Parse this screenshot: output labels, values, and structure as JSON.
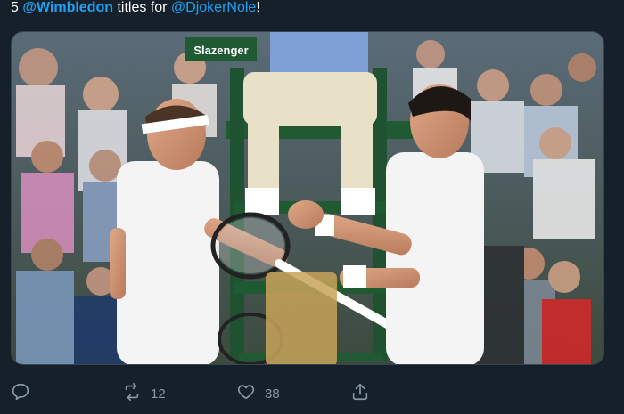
{
  "tweet": {
    "text_prefix": "5 ",
    "mention_1": "@Wimbledon",
    "text_middle": " titles for ",
    "mention_2": "@DjokerNole",
    "text_suffix": "!"
  },
  "media": {
    "chair_sign": "Slazenger",
    "scene": "photo"
  },
  "actions": {
    "reply_icon": "reply-icon",
    "retweet_icon": "retweet-icon",
    "retweet_count": "12",
    "like_icon": "heart-icon",
    "like_count": "38",
    "share_icon": "share-icon"
  },
  "colors": {
    "background": "#15202b",
    "link": "#1da1f2",
    "muted": "#8899a6"
  }
}
